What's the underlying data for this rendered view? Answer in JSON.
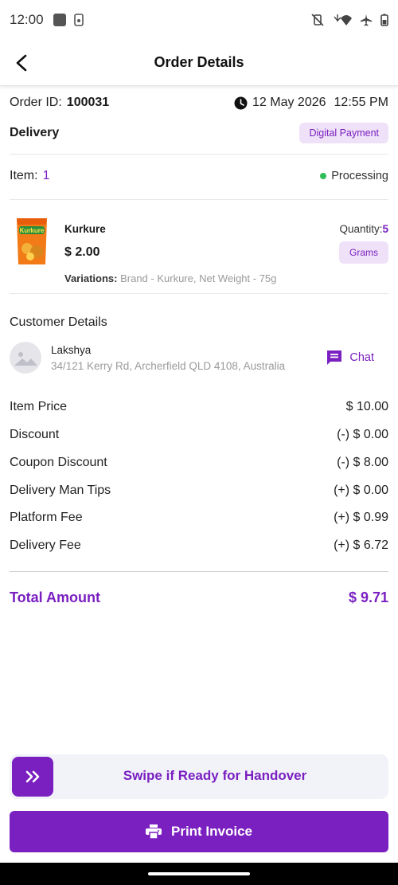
{
  "status_bar": {
    "time": "12:00"
  },
  "header": {
    "title": "Order Details"
  },
  "order": {
    "id_label": "Order ID:",
    "id": "100031",
    "date": "12 May 2026",
    "time": "12:55 PM",
    "type": "Delivery",
    "payment": "Digital Payment",
    "item_label": "Item:",
    "item_count": "1",
    "status": "Processing"
  },
  "product": {
    "name": "Kurkure",
    "price": "$ 2.00",
    "variations_label": "Variations:",
    "variations_value": "Brand - Kurkure,  Net Weight - 75g",
    "quantity_label": "Quantity:",
    "quantity": "5",
    "unit": "Grams",
    "brand_text": "Kurkure"
  },
  "customer": {
    "section_title": "Customer Details",
    "name": "Lakshya",
    "address": "34/121 Kerry Rd, Archerfield QLD 4108, Australia",
    "chat_label": "Chat"
  },
  "price_breakdown": [
    {
      "label": "Item Price",
      "value": "$ 10.00"
    },
    {
      "label": "Discount",
      "value": "(-) $ 0.00"
    },
    {
      "label": "Coupon Discount",
      "value": "(-) $ 8.00"
    },
    {
      "label": "Delivery Man Tips",
      "value": "(+) $ 0.00"
    },
    {
      "label": "Platform Fee",
      "value": "(+) $ 0.99"
    },
    {
      "label": "Delivery Fee",
      "value": "(+) $ 6.72"
    }
  ],
  "total": {
    "label": "Total Amount",
    "value": "$ 9.71"
  },
  "actions": {
    "swipe_label": "Swipe if Ready for Handover",
    "print_label": "Print Invoice"
  },
  "colors": {
    "accent": "#7a1fc0",
    "chip_bg": "#efe2f8",
    "status_green": "#2ebd59"
  }
}
